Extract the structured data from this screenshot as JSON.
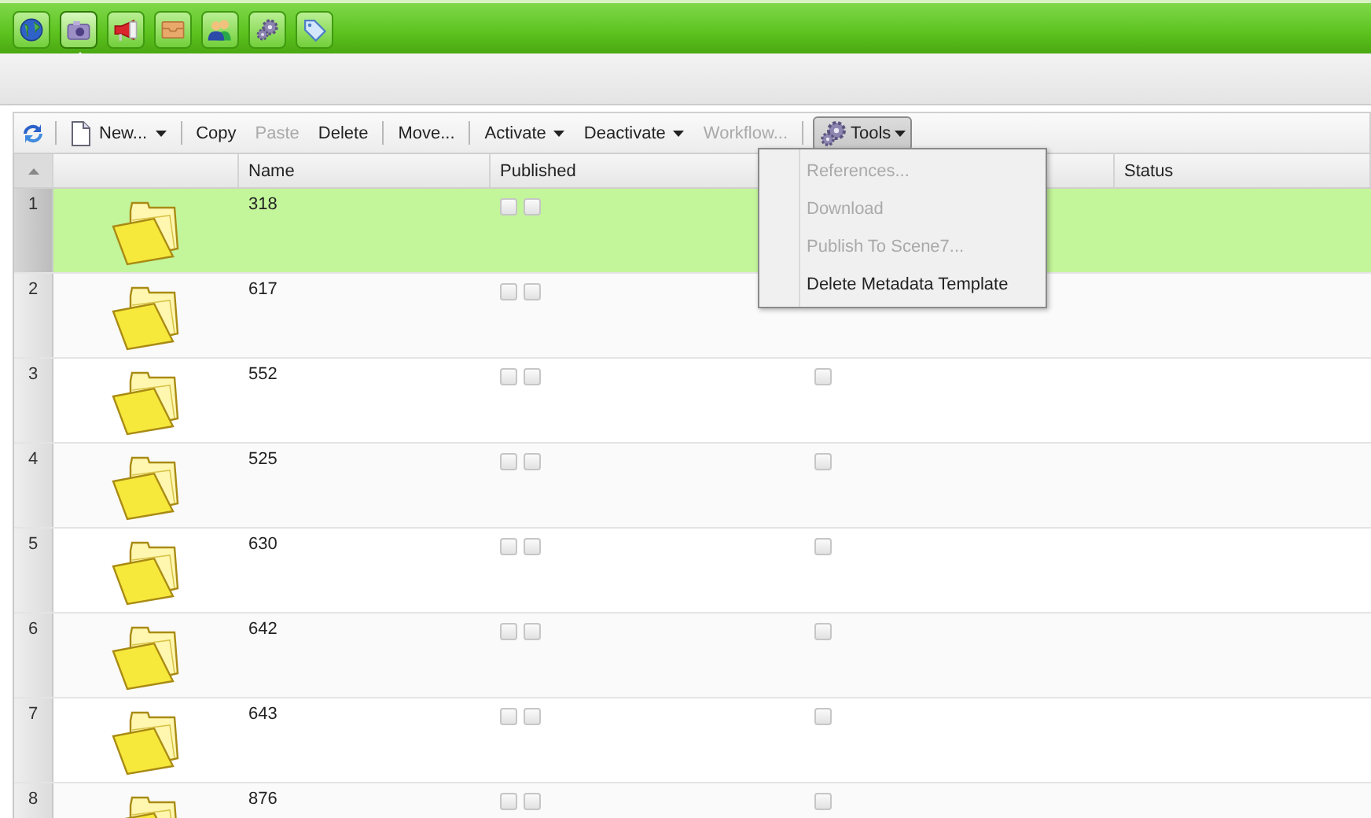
{
  "nav": [
    {
      "selected": false
    },
    {
      "selected": true
    },
    {
      "selected": false
    },
    {
      "selected": false
    },
    {
      "selected": false
    },
    {
      "selected": false
    },
    {
      "selected": false
    }
  ],
  "toolbar": [
    {
      "kind": "refresh"
    },
    {
      "kind": "sep"
    },
    {
      "kind": "new",
      "label": "New...",
      "disabled": false
    },
    {
      "kind": "sep"
    },
    {
      "kind": "button",
      "label": "Copy",
      "disabled": false
    },
    {
      "kind": "button",
      "label": "Paste",
      "disabled": true
    },
    {
      "kind": "button",
      "label": "Delete",
      "disabled": false
    },
    {
      "kind": "sep"
    },
    {
      "kind": "button",
      "label": "Move...",
      "disabled": false
    },
    {
      "kind": "sep"
    },
    {
      "kind": "menu",
      "label": "Activate",
      "disabled": false
    },
    {
      "kind": "menu",
      "label": "Deactivate",
      "disabled": false
    },
    {
      "kind": "button",
      "label": "Workflow...",
      "disabled": true
    },
    {
      "kind": "sep"
    },
    {
      "kind": "tools",
      "label": "Tools",
      "pressed": true
    }
  ],
  "table": {
    "columns": [
      "Name",
      "Published",
      "Status"
    ],
    "rows": [
      {
        "number": "1",
        "name": "318",
        "selected": true,
        "published": [
          false,
          false
        ]
      },
      {
        "number": "2",
        "name": "617",
        "selected": false,
        "published": [
          false,
          false
        ]
      },
      {
        "number": "3",
        "name": "552",
        "selected": false,
        "published": [
          false,
          false
        ],
        "column_4": false
      },
      {
        "number": "4",
        "name": "525",
        "selected": false,
        "published": [
          false,
          false
        ],
        "column_4": false
      },
      {
        "number": "5",
        "name": "630",
        "selected": false,
        "published": [
          false,
          false
        ],
        "column_4": false
      },
      {
        "number": "6",
        "name": "642",
        "selected": false,
        "published": [
          false,
          false
        ],
        "column_4": false
      },
      {
        "number": "7",
        "name": "643",
        "selected": false,
        "published": [
          false,
          false
        ],
        "column_4": false
      },
      {
        "number": "8",
        "name": "876",
        "selected": false,
        "published": [
          false,
          false
        ],
        "column_4": false
      }
    ]
  },
  "tools_menu": [
    {
      "label": "References...",
      "disabled": true
    },
    {
      "label": "Download",
      "disabled": true
    },
    {
      "label": "Publish To Scene7...",
      "disabled": true
    },
    {
      "label": "Delete Metadata Template",
      "disabled": false
    }
  ]
}
